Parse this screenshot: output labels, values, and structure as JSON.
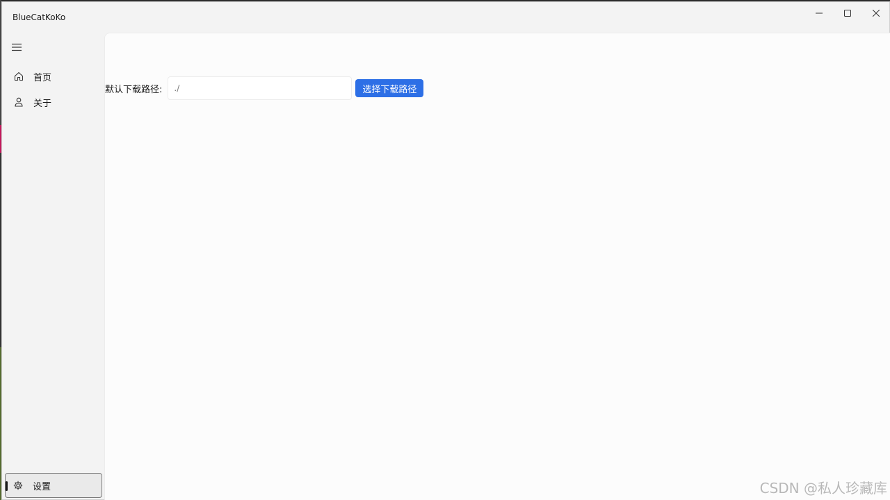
{
  "window": {
    "title": "BlueCatKoKo"
  },
  "window_controls": {
    "minimize": "─",
    "maximize": "☐",
    "close": "✕"
  },
  "sidebar": {
    "items": [
      {
        "label": "首页",
        "icon": "home-icon"
      },
      {
        "label": "关于",
        "icon": "person-icon"
      }
    ],
    "footer_item": {
      "label": "设置",
      "icon": "gear-icon"
    }
  },
  "download_setting": {
    "label": "默认下载路径:",
    "path_value": "./",
    "button_label": "选择下载路径"
  },
  "watermark": "CSDN @私人珍藏库",
  "colors": {
    "accent": "#2d6fe6",
    "background": "#fcfcfc",
    "sidebar": "#f3f3f3"
  }
}
